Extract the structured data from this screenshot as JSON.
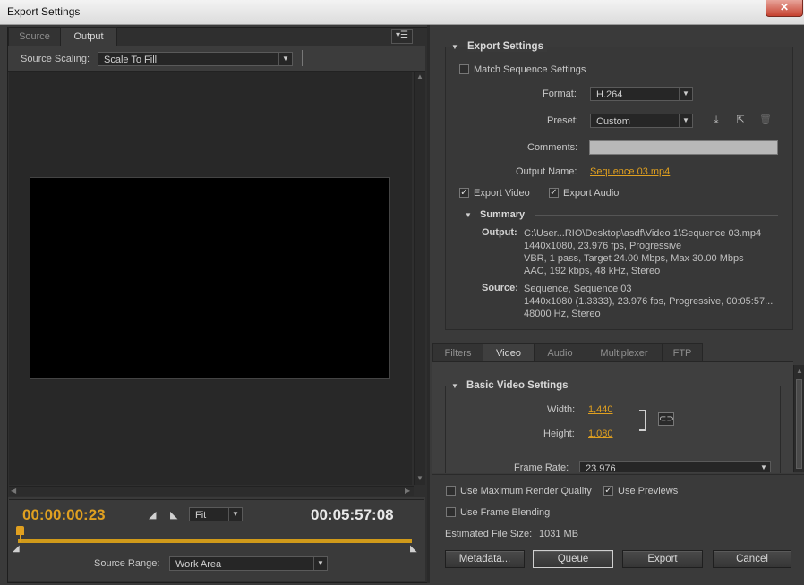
{
  "window": {
    "title": "Export Settings",
    "close_glyph": "✕"
  },
  "left": {
    "tabs": [
      {
        "label": "Source"
      },
      {
        "label": "Output"
      }
    ],
    "panel_menu_glyph": "▾☰",
    "source_scaling_label": "Source Scaling:",
    "source_scaling_value": "Scale To Fill",
    "current_timecode": "00:00:00:23",
    "duration_timecode": "00:05:57:08",
    "zoom_value": "Fit",
    "source_range_label": "Source Range:",
    "source_range_value": "Work Area",
    "set_in_glyph": "◢",
    "set_out_glyph": "◣"
  },
  "export_settings": {
    "header": "Export Settings",
    "match_sequence_label": "Match Sequence Settings",
    "match_sequence_checked": false,
    "format_label": "Format:",
    "format_value": "H.264",
    "preset_label": "Preset:",
    "preset_value": "Custom",
    "preset_icons": [
      "save-preset-icon",
      "import-preset-icon",
      "delete-preset-icon"
    ],
    "comments_label": "Comments:",
    "comments_value": "",
    "output_name_label": "Output Name:",
    "output_name_value": "Sequence 03.mp4",
    "export_video_label": "Export Video",
    "export_video_checked": true,
    "export_audio_label": "Export Audio",
    "export_audio_checked": true
  },
  "summary": {
    "header": "Summary",
    "output_label": "Output:",
    "output_lines": [
      "C:\\User...RIO\\Desktop\\asdf\\Video 1\\Sequence 03.mp4",
      "1440x1080, 23.976 fps, Progressive",
      "VBR, 1 pass, Target 24.00 Mbps, Max 30.00 Mbps",
      "AAC, 192 kbps, 48 kHz, Stereo"
    ],
    "source_label": "Source:",
    "source_lines": [
      "Sequence, Sequence 03",
      "1440x1080 (1.3333), 23.976 fps, Progressive, 00:05:57...",
      "48000 Hz, Stereo"
    ]
  },
  "settings_tabs": [
    {
      "label": "Filters"
    },
    {
      "label": "Video"
    },
    {
      "label": "Audio"
    },
    {
      "label": "Multiplexer"
    },
    {
      "label": "FTP"
    }
  ],
  "basic_video": {
    "header": "Basic Video Settings",
    "width_label": "Width:",
    "width_value": "1,440",
    "height_label": "Height:",
    "height_value": "1,080",
    "frame_rate_label": "Frame Rate:",
    "frame_rate_value": "23.976"
  },
  "bottom": {
    "max_render_label": "Use Maximum Render Quality",
    "max_render_checked": false,
    "use_previews_label": "Use Previews",
    "use_previews_checked": true,
    "frame_blending_label": "Use Frame Blending",
    "frame_blending_checked": false,
    "file_size_label": "Estimated File Size:",
    "file_size_value": "1031 MB",
    "buttons": {
      "metadata": "Metadata...",
      "queue": "Queue",
      "export": "Export",
      "cancel": "Cancel"
    }
  },
  "colors": {
    "accent": "#e0a020",
    "panel": "#3a3a3a",
    "preview_bg": "#282828"
  }
}
